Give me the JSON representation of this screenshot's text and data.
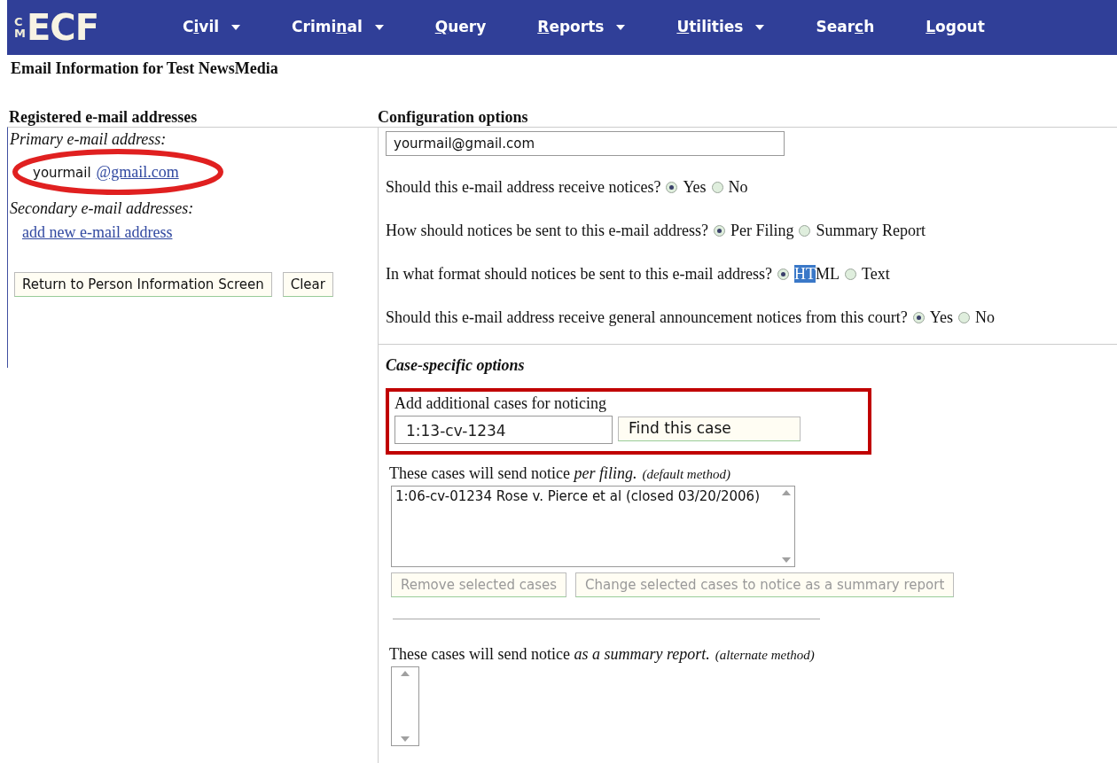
{
  "nav": {
    "logo": {
      "small": "CM",
      "big": "ECF"
    },
    "items": [
      {
        "before": "C",
        "key": "i",
        "after": "vil",
        "dropdown": true
      },
      {
        "before": "Crimi",
        "key": "n",
        "after": "al",
        "dropdown": true
      },
      {
        "key": "Q",
        "after": "uery",
        "dropdown": false
      },
      {
        "key": "R",
        "after": "eports",
        "dropdown": true
      },
      {
        "key": "U",
        "after": "tilities",
        "dropdown": true
      },
      {
        "before": "Sear",
        "key": "c",
        "after": "h",
        "dropdown": false
      },
      {
        "key": "L",
        "after": "ogout",
        "dropdown": false
      }
    ]
  },
  "page_title": "Email Information for Test NewsMedia",
  "registered": {
    "heading": "Registered e-mail addresses",
    "primary_label": "Primary e-mail address:",
    "primary_user": "yourmail",
    "primary_domain": "@gmail.com",
    "secondary_label": "Secondary e-mail addresses:",
    "add_link": "add new e-mail address",
    "buttons": [
      "Return to Person Information Screen",
      "Clear"
    ]
  },
  "config": {
    "heading": "Configuration options",
    "email_user": "yourmail",
    "email_domain": "@gmail.com",
    "questions": [
      {
        "text": "Should this e-mail address receive notices?",
        "options": [
          {
            "label": "Yes",
            "selected": true
          },
          {
            "label": "No",
            "selected": false
          }
        ]
      },
      {
        "text": "How should notices be sent to this e-mail address?",
        "options": [
          {
            "label": "Per Filing",
            "selected": true
          },
          {
            "label": "Summary Report",
            "selected": false
          }
        ]
      },
      {
        "text": "In what format should notices be sent to this e-mail address?",
        "options": [
          {
            "highlighted": "HT",
            "label": "ML",
            "selected": true
          },
          {
            "label": "Text",
            "selected": false
          }
        ]
      },
      {
        "text": "Should this e-mail address receive general announcement notices from this court?",
        "options": [
          {
            "label": "Yes",
            "selected": true
          },
          {
            "label": "No",
            "selected": false
          }
        ]
      }
    ]
  },
  "case_options": {
    "heading": "Case-specific options",
    "add_label": "Add additional cases for noticing",
    "case_value": "1:13-cv-1234",
    "find_button": "Find this case",
    "per_filing_label": "These cases will send notice *per filing.*",
    "per_filing_note": "(default method)",
    "per_filing_cases": [
      "1:06-cv-01234 Rose v. Pierce et al (closed 03/20/2006)"
    ],
    "per_filing_buttons": [
      {
        "label": "Remove selected cases",
        "disabled": true
      },
      {
        "label": "Change selected cases to notice as a summary report",
        "disabled": true
      }
    ],
    "summary_label": "These cases will send notice *as a summary report.*",
    "summary_note": "(alternate method)"
  }
}
